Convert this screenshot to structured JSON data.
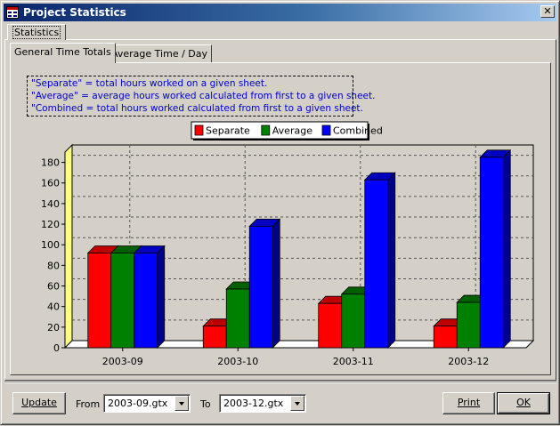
{
  "window": {
    "title": "Project Statistics",
    "close_label": "✕"
  },
  "outer_tab": {
    "label": "Statistics"
  },
  "inner_tabs": [
    {
      "label": "General Time Totals",
      "active": true
    },
    {
      "label": "Average Time / Day",
      "active": false
    }
  ],
  "notes": [
    "\"Separate\" = total hours worked on a given sheet.",
    "\"Average\" = average hours worked calculated from first to a given sheet.",
    "\"Combined = total hours worked calculated from first to a given sheet."
  ],
  "chart_data": {
    "type": "bar",
    "style": "3d-grouped",
    "categories": [
      "2003-09",
      "2003-10",
      "2003-11",
      "2003-12"
    ],
    "series": [
      {
        "name": "Separate",
        "color": "#ff0000",
        "values": [
          92,
          21,
          43,
          21
        ]
      },
      {
        "name": "Average",
        "color": "#008000",
        "values": [
          92,
          57,
          52,
          44
        ]
      },
      {
        "name": "Combined",
        "color": "#0000ff",
        "values": [
          92,
          118,
          163,
          185
        ]
      }
    ],
    "ylim": [
      0,
      190
    ],
    "yticks": [
      0,
      20,
      40,
      60,
      80,
      100,
      120,
      140,
      160,
      180
    ],
    "grid": true,
    "legend_position": "top-center",
    "xlabel": "",
    "ylabel": ""
  },
  "bottom": {
    "update_label": "Update",
    "from_label": "From",
    "from_value": "2003-09.gtx",
    "to_label": "To",
    "to_value": "2003-12.gtx",
    "print_label": "Print",
    "ok_label": "OK"
  }
}
